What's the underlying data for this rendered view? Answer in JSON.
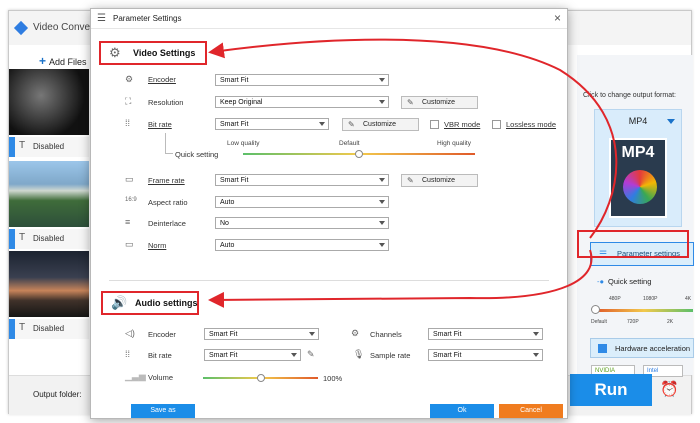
{
  "app": {
    "title": "Video Converter",
    "add_files": "Add Files",
    "clips": [
      {
        "subtitle": "Disabled"
      },
      {
        "subtitle": "Disabled"
      },
      {
        "subtitle": "Disabled"
      }
    ],
    "output_folder_label": "Output folder:",
    "run_label": "Run"
  },
  "right_panel": {
    "change_format_label": "Click to change output format:",
    "format_name": "MP4",
    "format_badge": "MP4",
    "parameter_settings_label": "Parameter settings",
    "quick_setting_label": "Quick setting",
    "quick_top_ticks": [
      "480P",
      "1080P",
      "4K"
    ],
    "quick_bottom_ticks": [
      "Default",
      "720P",
      "2K"
    ],
    "hardware_accel_label": "Hardware acceleration",
    "gpu_labels": [
      "NVIDIA",
      "Intel"
    ]
  },
  "dialog": {
    "title": "Parameter Settings",
    "video_section": "Video Settings",
    "audio_section": "Audio settings",
    "video": {
      "encoder_label": "Encoder",
      "encoder_value": "Smart Fit",
      "resolution_label": "Resolution",
      "resolution_value": "Keep Original",
      "bitrate_label": "Bit rate",
      "bitrate_value": "Smart Fit",
      "vbr_label": "VBR mode",
      "lossless_label": "Lossless mode",
      "quick_setting_label": "Quick setting",
      "quality_low": "Low quality",
      "quality_default": "Default",
      "quality_high": "High quality",
      "quality_level": 0.5,
      "framerate_label": "Frame rate",
      "framerate_value": "Smart Fit",
      "aspect_label": "Aspect ratio",
      "aspect_value": "Auto",
      "deinterlace_label": "Deinterlace",
      "deinterlace_value": "No",
      "norm_label": "Norm",
      "norm_value": "Auto",
      "customize_label": "Customize",
      "aspect_icon_text": "16:9"
    },
    "audio": {
      "encoder_label": "Encoder",
      "encoder_value": "Smart Fit",
      "channels_label": "Channels",
      "channels_value": "Smart Fit",
      "bitrate_label": "Bit rate",
      "bitrate_value": "Smart Fit",
      "samplerate_label": "Sample rate",
      "samplerate_value": "Smart Fit",
      "volume_label": "Volume",
      "volume_value": "100%",
      "volume_level": 1.0
    },
    "save_as_label": "Save as",
    "ok_label": "Ok",
    "cancel_label": "Cancel"
  },
  "colors": {
    "accent": "#1b8de8",
    "annotation": "#e0262b",
    "cancel": "#f07c1f"
  }
}
